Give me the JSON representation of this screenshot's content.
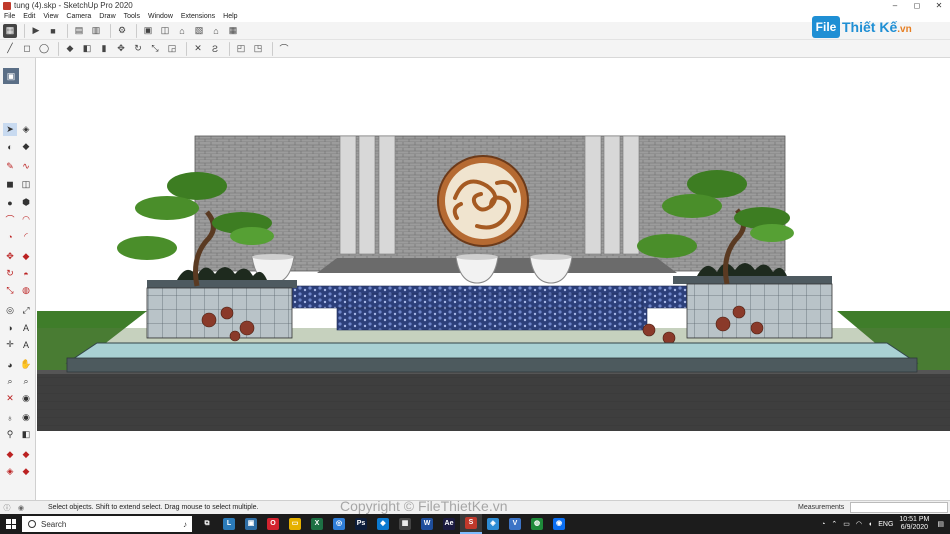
{
  "window": {
    "title": "tung (4).skp - SketchUp Pro 2020",
    "minimize": "–",
    "maximize": "◻",
    "close": "✕"
  },
  "menu": [
    "File",
    "Edit",
    "View",
    "Camera",
    "Draw",
    "Tools",
    "Window",
    "Extensions",
    "Help"
  ],
  "logo": {
    "mark": "File",
    "name": "Thiết Kế",
    "suffix": ".vn"
  },
  "status": {
    "text": "Select objects. Shift to extend select. Drag mouse to select multiple.",
    "measurements_label": "Measurements",
    "measurements_value": ""
  },
  "watermark": "Copyright © FileThietKe.vn",
  "taskbar": {
    "search_placeholder": "Search",
    "apps": [
      {
        "name": "task-view-icon",
        "glyph": "⧉",
        "color": "#1c1c1c"
      },
      {
        "name": "sketchup-layout-icon",
        "glyph": "L",
        "color": "#2b7bb9"
      },
      {
        "name": "photos-icon",
        "glyph": "▣",
        "color": "#2e6da4"
      },
      {
        "name": "opera-icon",
        "glyph": "O",
        "color": "#d3232f"
      },
      {
        "name": "file-explorer-icon",
        "glyph": "▭",
        "color": "#e6b100"
      },
      {
        "name": "excel-icon",
        "glyph": "X",
        "color": "#1d7044"
      },
      {
        "name": "chrome-icon",
        "glyph": "◎",
        "color": "#2f7ed8"
      },
      {
        "name": "photoshop-icon",
        "glyph": "Ps",
        "color": "#0d1d3a"
      },
      {
        "name": "store-icon",
        "glyph": "◆",
        "color": "#0b7ad1"
      },
      {
        "name": "calculator-icon",
        "glyph": "▦",
        "color": "#444"
      },
      {
        "name": "word-icon",
        "glyph": "W",
        "color": "#1e4e9c"
      },
      {
        "name": "after-effects-icon",
        "glyph": "Ae",
        "color": "#1b1a3f"
      },
      {
        "name": "sketchup-icon",
        "glyph": "S",
        "color": "#c0392b"
      },
      {
        "name": "maps-icon",
        "glyph": "◈",
        "color": "#2d8cd4"
      },
      {
        "name": "security-icon",
        "glyph": "V",
        "color": "#3c74c6"
      },
      {
        "name": "green-app-icon",
        "glyph": "◍",
        "color": "#1e8a3a"
      },
      {
        "name": "zalo-icon",
        "glyph": "◉",
        "color": "#0b6ff2"
      }
    ],
    "tray": {
      "language": "ENG",
      "time": "10:51 PM",
      "date": "6/9/2020"
    }
  }
}
